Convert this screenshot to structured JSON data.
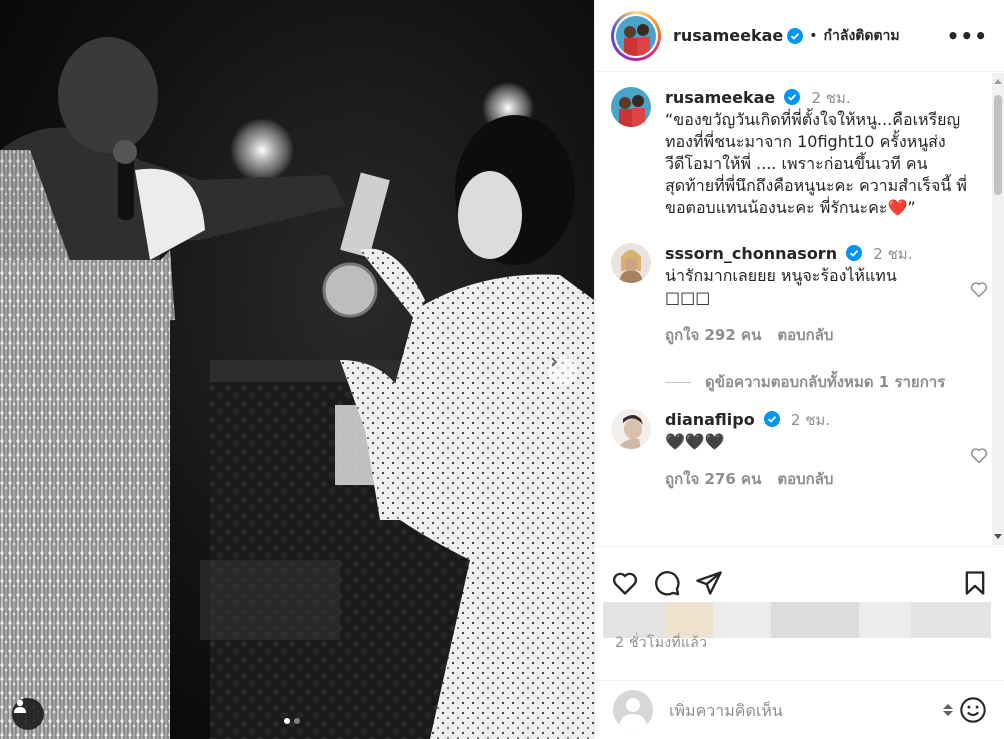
{
  "post": {
    "username": "rusameekae",
    "follow_label": "กำลังติดตาม",
    "separator": "•",
    "more_label": "•••"
  },
  "caption": {
    "username": "rusameekae",
    "time": "2 ชม.",
    "text": "“ของขวัญวันเกิดที่พี่ตั้งใจให้หนู...คือเหรียญทองที่พี่ชนะมาจาก 10fight10 ครั้งหนูส่งวีดีโอมาให้พี่ .... เพราะก่อนขึ้นเวที คนสุดท้ายที่พี่นึกถึงคือหนูนะคะ ความสำเร็จนี้ พี่ขอตอบแทนน้องนะคะ พี่รักนะคะ",
    "heart": "❤️",
    "end_quote": "”"
  },
  "comments": [
    {
      "username": "sssorn_chonnasorn",
      "time": "2 ชม.",
      "text": "น่ารักมากเลยยย หนูจะร้องไห้แทน",
      "emoji_boxes": "□□□",
      "likes": "ถูกใจ 292 คน",
      "reply_label": "ตอบกลับ",
      "view_replies": "ดูข้อความตอบกลับทั้งหมด 1 รายการ"
    },
    {
      "username": "dianaflipo",
      "time": "2 ชม.",
      "text": "🖤🖤🖤",
      "likes": "ถูกใจ 276 คน",
      "reply_label": "ตอบกลับ"
    }
  ],
  "actions": {
    "like_icon": "heart-outline-icon",
    "comment_icon": "comment-icon",
    "share_icon": "paper-plane-icon",
    "save_icon": "bookmark-icon"
  },
  "timestamp": "2 ชั่วโมงที่แล้ว",
  "add_comment": {
    "placeholder": "เพิ่มความคิดเห็น"
  },
  "colors": {
    "verified": "#0095f6",
    "meta_gray": "#8e8e8e",
    "text": "#262626"
  },
  "carousel": {
    "slide_count": 2,
    "active_index": 0
  }
}
